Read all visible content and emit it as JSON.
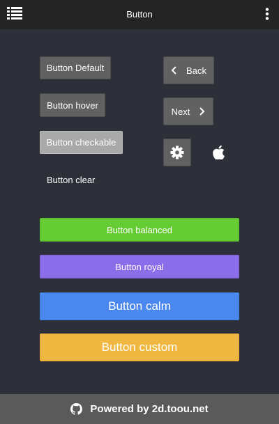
{
  "header": {
    "title": "Button",
    "menu_icon": "list-icon",
    "more_icon": "more-vertical-icon"
  },
  "buttons": {
    "default": "Button Default",
    "hover": "Button hover",
    "checkable": "Button checkable",
    "clear": "Button clear",
    "back": "Back",
    "next": "Next",
    "settings_icon": "gear-icon",
    "apple_icon": "apple-icon",
    "balanced": "Button balanced",
    "royal": "Button royal",
    "calm": "Button calm",
    "custom": "Button custom"
  },
  "footer": {
    "icon": "github-icon",
    "text": "Powered by 2d.toou.net"
  },
  "colors": {
    "background": "#2d3038",
    "header": "#242424",
    "default_button": "#616161",
    "checkable_button": "#a9a9a9",
    "balanced": "#66cc33",
    "royal": "#8a6de9",
    "calm": "#4a87ee",
    "custom": "#f0b840",
    "footer": "#5a5a5a"
  }
}
